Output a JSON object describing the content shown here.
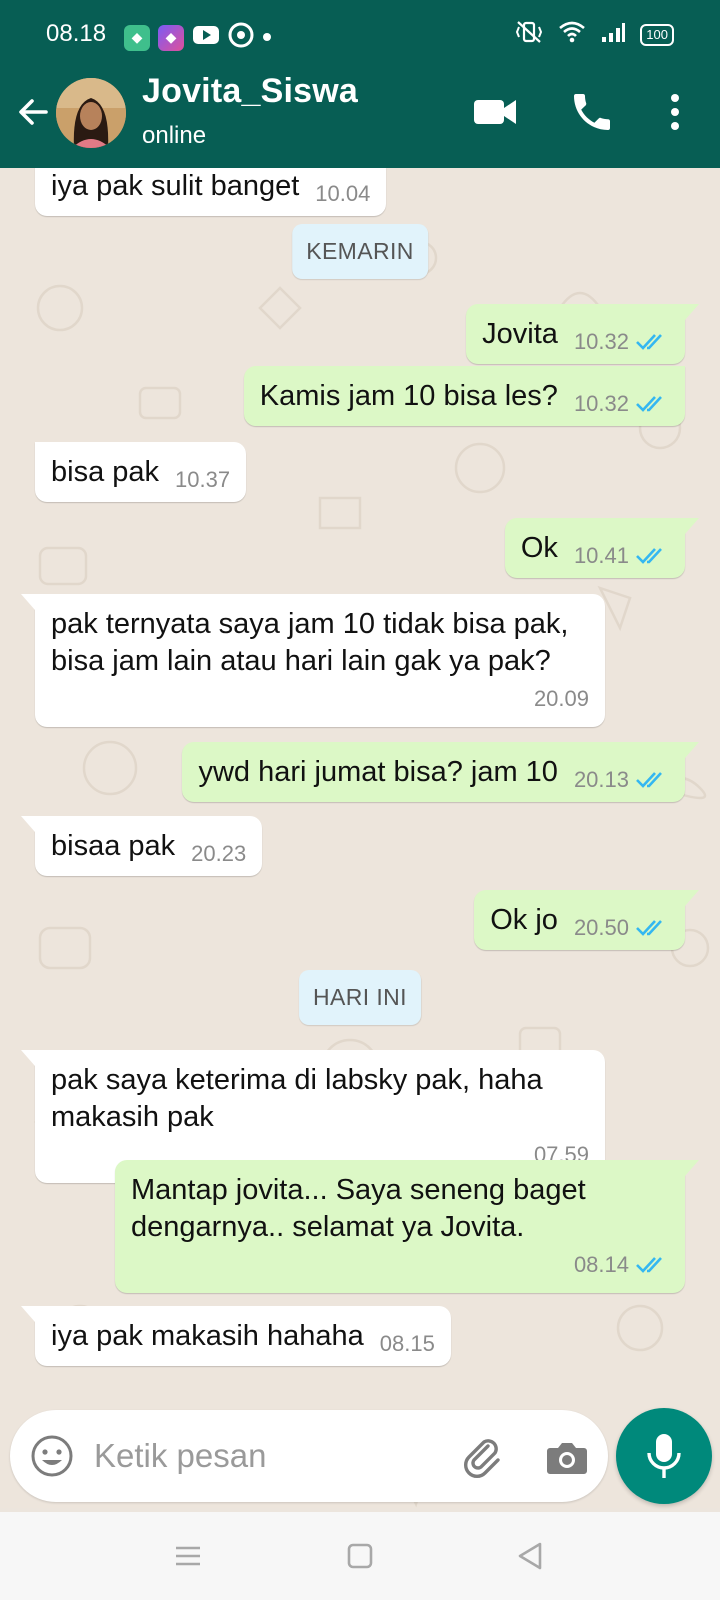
{
  "status_bar": {
    "time": "08.18",
    "battery": "100",
    "icons": [
      "app-icon-green",
      "app-icon-purple",
      "youtube-icon",
      "app-icon-whatsapp",
      "dot-icon",
      "mute-vibrate-icon",
      "wifi-icon",
      "signal-icon",
      "battery-icon"
    ]
  },
  "header": {
    "name": "Jovita_Siswa",
    "status": "online",
    "icons": [
      "back-arrow-icon",
      "video-call-icon",
      "phone-icon",
      "more-vert-icon"
    ],
    "colors": {
      "bar": "#075e54",
      "text": "#ffffff"
    }
  },
  "chat": {
    "colors": {
      "outgoing": "#dcf8c6",
      "incoming": "#ffffff",
      "read_ticks": "#34b7f1",
      "date_chip": "#e1f3fb"
    },
    "items": [
      {
        "type": "in",
        "text": "iya pak sulit banget",
        "time": "10.04"
      },
      {
        "type": "date",
        "text": "KEMARIN"
      },
      {
        "type": "out",
        "text": "Jovita",
        "time": "10.32"
      },
      {
        "type": "out",
        "text": "Kamis jam 10 bisa les?",
        "time": "10.32"
      },
      {
        "type": "in",
        "text": "bisa pak",
        "time": "10.37"
      },
      {
        "type": "out",
        "text": "Ok",
        "time": "10.41"
      },
      {
        "type": "in",
        "text": "pak ternyata saya jam 10 tidak bisa pak, bisa jam lain atau hari lain gak ya pak?",
        "time": "20.09"
      },
      {
        "type": "out",
        "text": "ywd hari jumat bisa? jam 10",
        "time": "20.13"
      },
      {
        "type": "in",
        "text": "bisaa pak",
        "time": "20.23"
      },
      {
        "type": "out",
        "text": "Ok jo",
        "time": "20.50"
      },
      {
        "type": "date",
        "text": "HARI INI"
      },
      {
        "type": "in",
        "text": "pak saya keterima di labsky pak, haha makasih pak",
        "time": "07.59"
      },
      {
        "type": "out",
        "text": "Mantap jovita... Saya seneng baget dengarnya.. selamat ya Jovita.",
        "time": "08.14"
      },
      {
        "type": "in",
        "text": "iya pak makasih hahaha",
        "time": "08.15"
      }
    ]
  },
  "composer": {
    "placeholder": "Ketik pesan",
    "icons": [
      "emoji-icon",
      "attach-icon",
      "camera-icon",
      "mic-icon"
    ],
    "mic_color": "#00897b"
  },
  "nav_bar": {
    "icons": [
      "recents-icon",
      "home-icon",
      "back-triangle-icon"
    ]
  }
}
